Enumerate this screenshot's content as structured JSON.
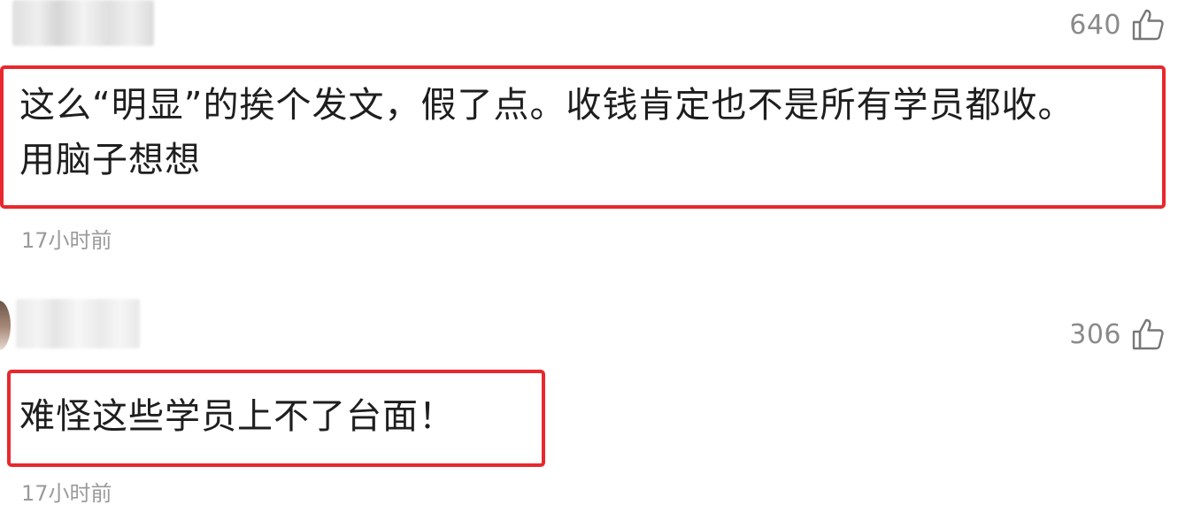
{
  "comments": [
    {
      "likes": "640",
      "line1": "这么“明显”的挨个发文，假了点。收钱肯定也不是所有学员都收。",
      "line2": "用脑子想想",
      "time": "17小时前"
    },
    {
      "likes": "306",
      "line1": "难怪这些学员上不了台面！",
      "time": "17小时前"
    }
  ],
  "icons": {
    "like": "thumbs-up-icon"
  },
  "colors": {
    "highlight": "#e8282d",
    "meta": "#9a9a9a",
    "text": "#1e1e1e"
  }
}
